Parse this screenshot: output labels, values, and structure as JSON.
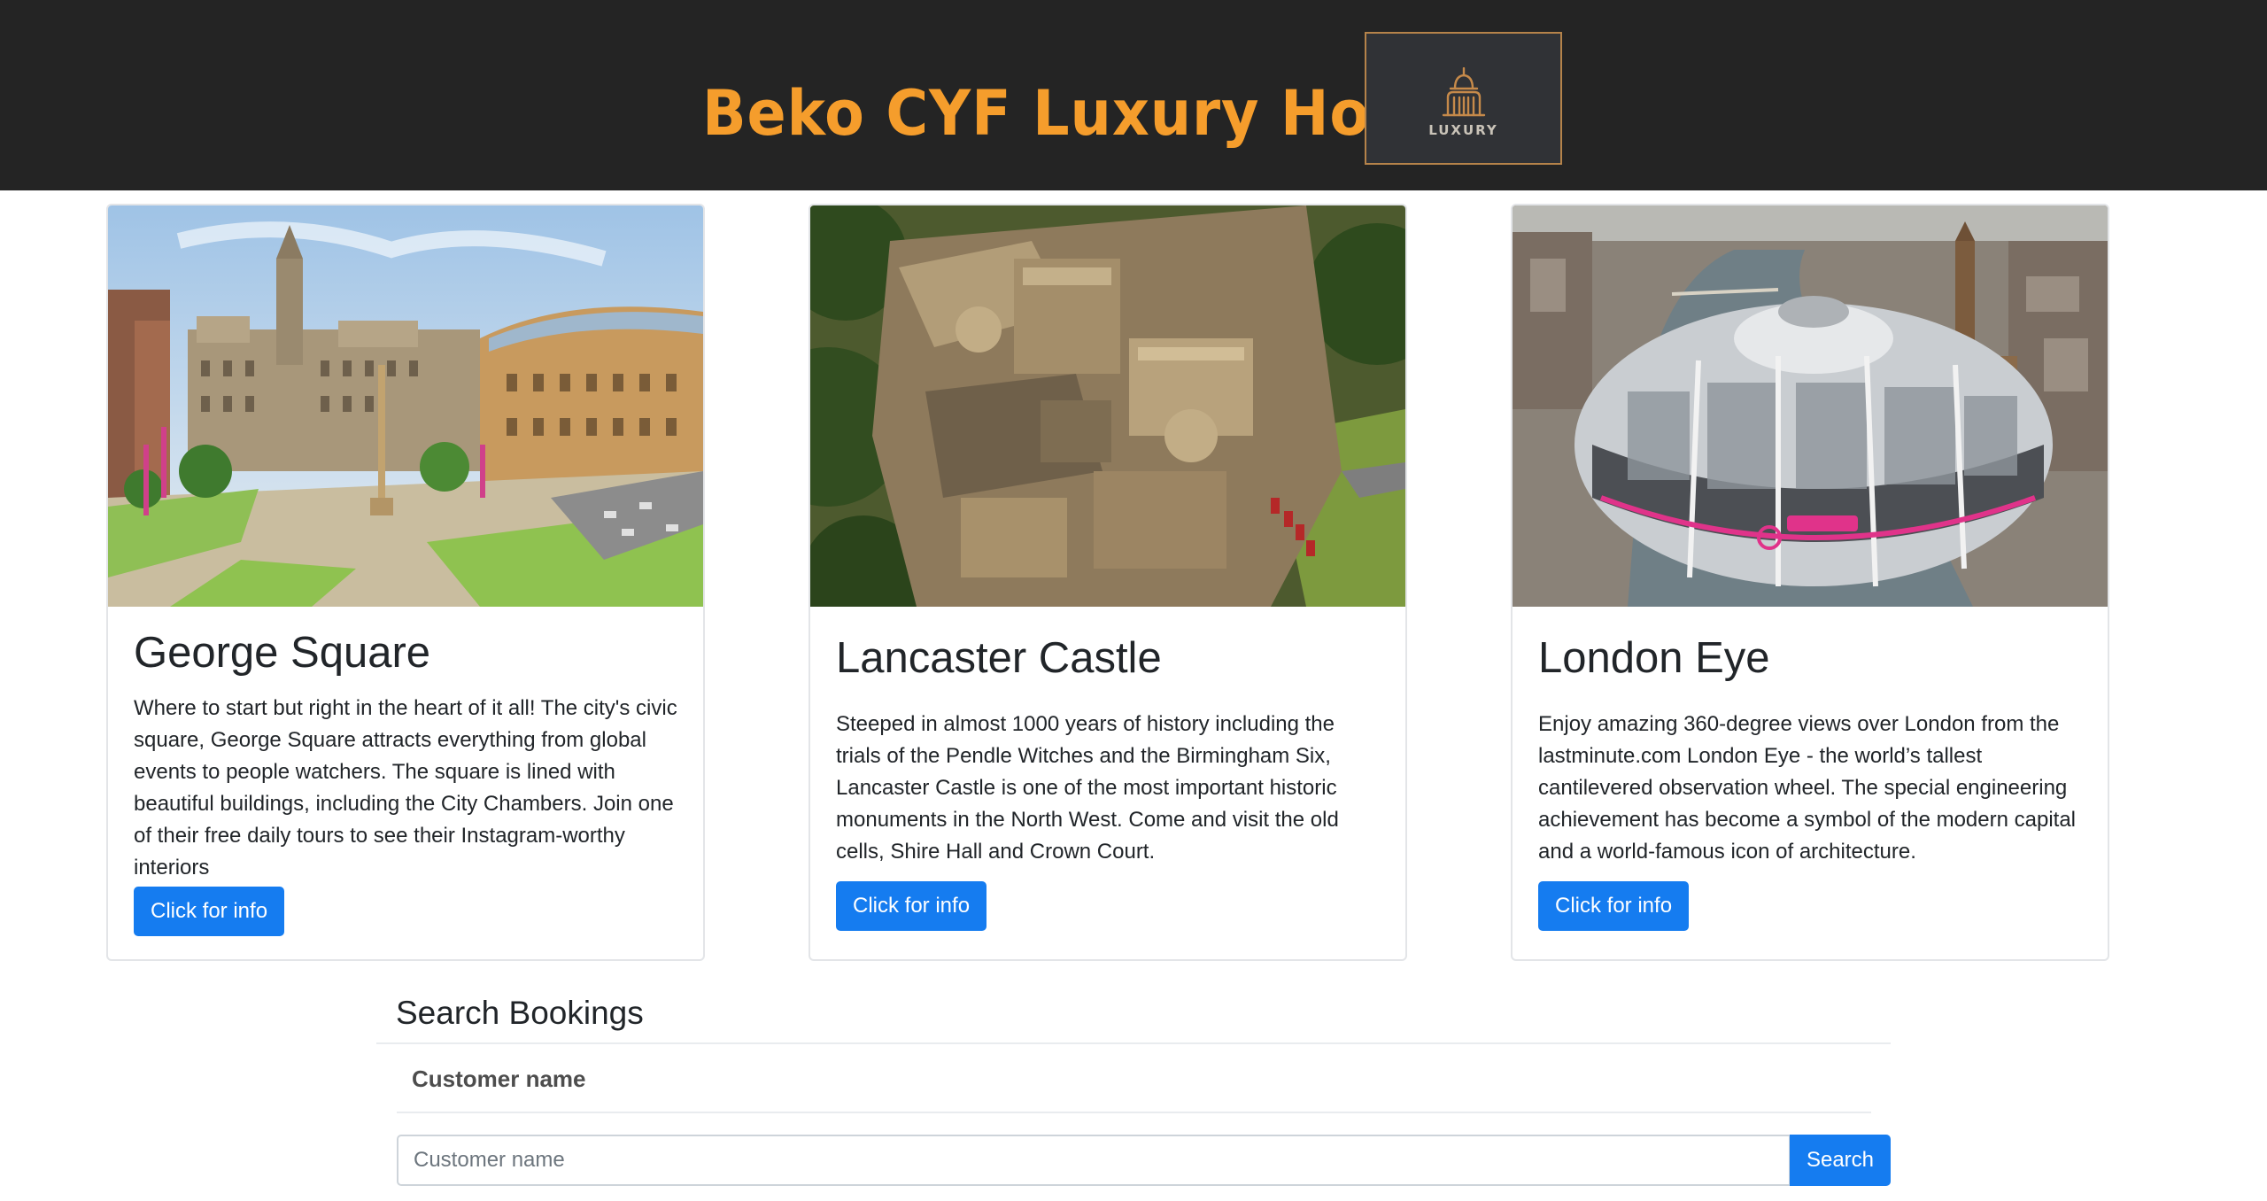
{
  "header": {
    "title": "Beko CYF Luxury Hotel",
    "logo_text": "LUXURY",
    "colors": {
      "background": "#242424",
      "title": "#f59d2c",
      "logo_border": "#b5834a"
    }
  },
  "cards": [
    {
      "image": "george-square-photo",
      "title": "George Square",
      "text": "Where to start but right in the heart of it all! The city's civic square, George Square attracts everything from global events to people watchers. The square is lined with beautiful buildings, including the City Chambers. Join one of their free daily tours to see their Instagram-worthy interiors",
      "button": "Click for info"
    },
    {
      "image": "lancaster-castle-photo",
      "title": "Lancaster Castle",
      "text": "Steeped in almost 1000 years of history including the trials of the Pendle Witches and the Birmingham Six, Lancaster Castle is one of the most important historic monuments in the North West. Come and visit the old cells, Shire Hall and Crown Court.",
      "button": "Click for info"
    },
    {
      "image": "london-eye-photo",
      "title": "London Eye",
      "text": "Enjoy amazing 360-degree views over London from the lastminute.com London Eye - the world’s tallest cantilevered observation wheel. The special engineering achievement has become a symbol of the modern capital and a world-famous icon of architecture.",
      "button": "Click for info"
    }
  ],
  "search": {
    "heading": "Search Bookings",
    "label": "Customer name",
    "placeholder": "Customer name",
    "value": "",
    "button": "Search"
  },
  "accent_color": "#157cf0"
}
